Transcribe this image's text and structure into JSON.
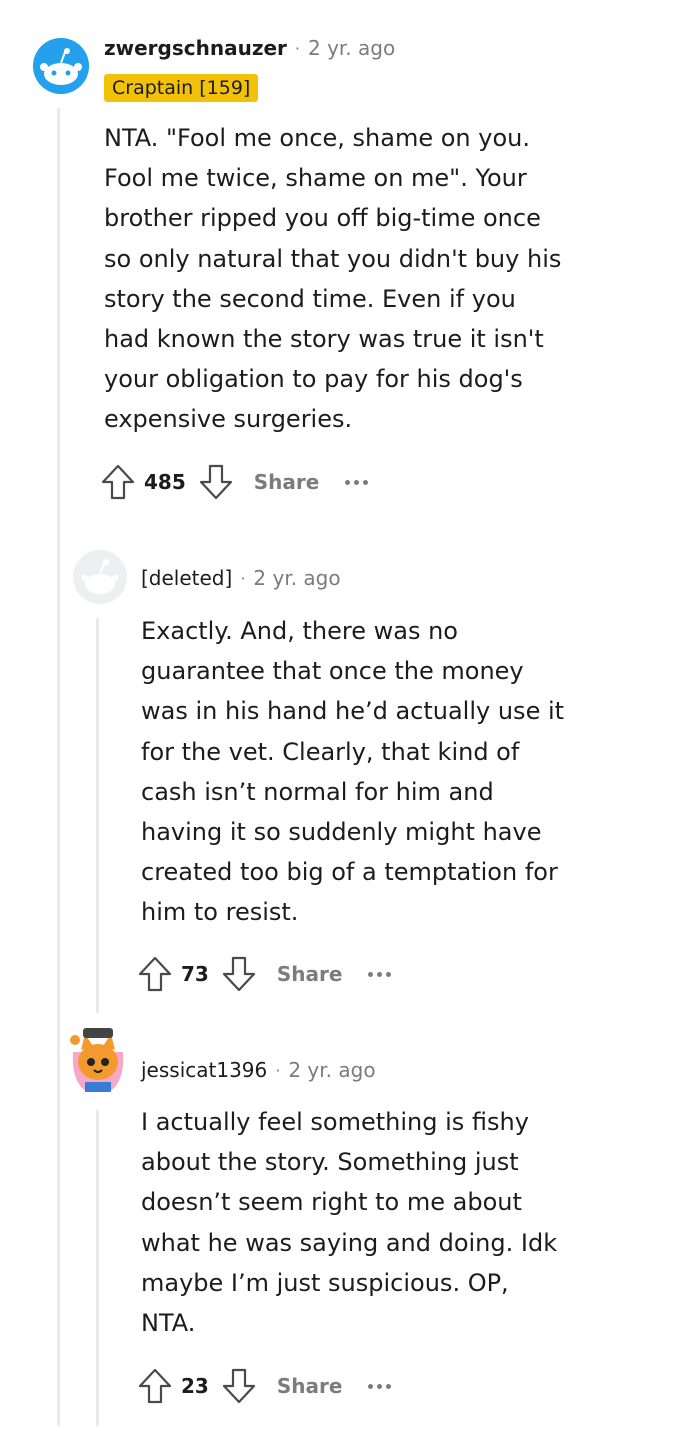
{
  "comments": [
    {
      "author": "zwergschnauzer",
      "time": "2 yr. ago",
      "flair": "Craptain [159]",
      "body": "NTA. \"Fool me once, shame on you.\nFool me twice, shame on me\". Your\nbrother ripped you off big-time once\nso only natural that you didn't buy his\nstory the second time. Even if you\nhad known the story was true it isn't\nyour obligation to pay for his dog's\nexpensive surgeries.",
      "votes": "485",
      "share_label": "Share"
    },
    {
      "author": "[deleted]",
      "time": "2 yr. ago",
      "body": "Exactly. And, there was no\nguarantee that once the money\nwas in his hand he’d actually use it\nfor the vet. Clearly, that kind of\ncash isn’t normal for him and\nhaving it so suddenly might have\ncreated too big of a temptation for\nhim to resist.",
      "votes": "73",
      "share_label": "Share"
    },
    {
      "author": "jessicat1396",
      "time": "2 yr. ago",
      "body": "I actually feel something is fishy\nabout the story. Something just\ndoesn’t seem right to me about\nwhat he was saying and doing. Idk\nmaybe I’m just suspicious. OP,\nNTA.",
      "votes": "23",
      "share_label": "Share"
    }
  ],
  "meta_separator": "·",
  "icons": {
    "upvote": "upvote-arrow-icon",
    "downvote": "downvote-arrow-icon",
    "more": "more-options-icon"
  },
  "colors": {
    "flair_bg": "#f2c20a",
    "muted_text": "#7c7c7c",
    "thread_line": "#e9e9e9",
    "avatar_blue": "#0dd3bb"
  }
}
